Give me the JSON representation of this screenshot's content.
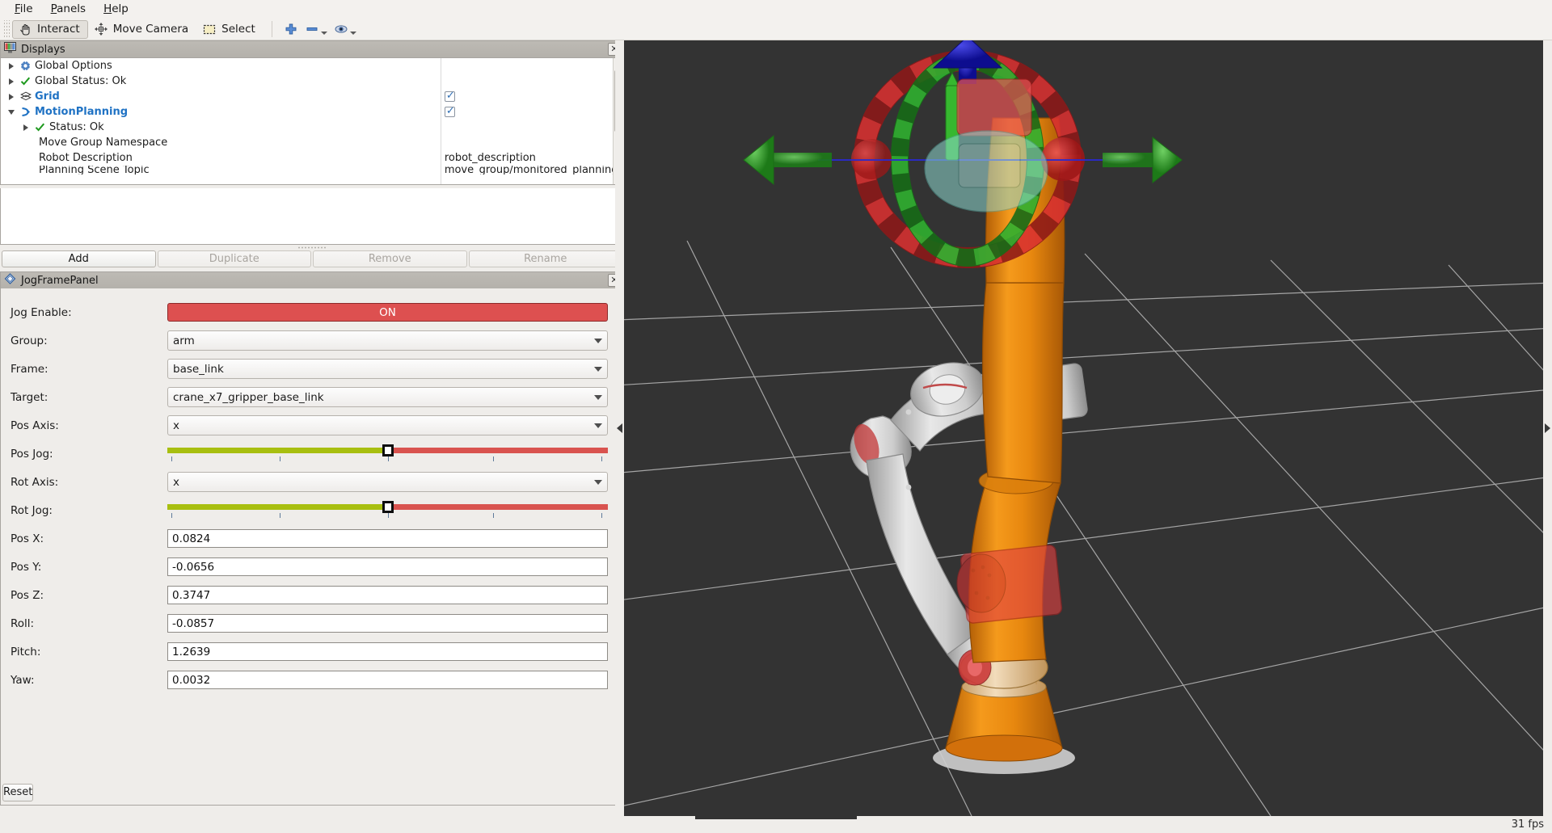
{
  "menubar": {
    "items": [
      {
        "label": "File",
        "mnemonic": "F"
      },
      {
        "label": "Panels",
        "mnemonic": "P"
      },
      {
        "label": "Help",
        "mnemonic": "H"
      }
    ]
  },
  "toolbar": {
    "interact_label": "Interact",
    "move_camera_label": "Move Camera",
    "select_label": "Select",
    "interact_icon": "hand-cursor-icon",
    "move_camera_icon": "four-way-arrow-icon",
    "select_icon": "dashed-rectangle-icon",
    "plus_icon": "plus-icon",
    "minus_icon": "minus-icon",
    "eye_icon": "eye-icon"
  },
  "displays_panel": {
    "title": "Displays",
    "title_icon": "displays-icon",
    "close_label": "✕",
    "rows": [
      {
        "indent": 0,
        "expander": "right",
        "icon": "gear-icon",
        "label": "Global Options",
        "link": false,
        "checkbox": null,
        "value": ""
      },
      {
        "indent": 0,
        "expander": "right",
        "icon": "check-icon",
        "label": "Global Status: Ok",
        "link": false,
        "checkbox": null,
        "value": ""
      },
      {
        "indent": 0,
        "expander": "right",
        "icon": "grid-icon",
        "label": "Grid",
        "link": true,
        "checkbox": true,
        "value": ""
      },
      {
        "indent": 0,
        "expander": "down",
        "icon": "motionplanning-icon",
        "label": "MotionPlanning",
        "link": true,
        "checkbox": true,
        "value": ""
      },
      {
        "indent": 1,
        "expander": "right",
        "icon": "check-icon",
        "label": "Status: Ok",
        "link": false,
        "checkbox": null,
        "value": ""
      },
      {
        "indent": 1,
        "expander": "none",
        "icon": "none",
        "label": "Move Group Namespace",
        "link": false,
        "checkbox": null,
        "value": ""
      },
      {
        "indent": 1,
        "expander": "none",
        "icon": "none",
        "label": "Robot Description",
        "link": false,
        "checkbox": null,
        "value": "robot_description"
      },
      {
        "indent": 1,
        "expander": "none",
        "icon": "none",
        "label": "Planning Scene Topic",
        "link": false,
        "checkbox": null,
        "value": "move_group/monitored_planning_"
      }
    ],
    "buttons": [
      {
        "label": "Add",
        "enabled": true
      },
      {
        "label": "Duplicate",
        "enabled": false
      },
      {
        "label": "Remove",
        "enabled": false
      },
      {
        "label": "Rename",
        "enabled": false
      }
    ]
  },
  "jog_panel": {
    "title": "JogFramePanel",
    "title_icon": "diamond-icon",
    "close_label": "✕",
    "reset_label": "Reset",
    "fields": [
      {
        "key": "jog_enable",
        "label": "Jog Enable:",
        "type": "toggle",
        "value": "ON"
      },
      {
        "key": "group",
        "label": "Group:",
        "type": "combo",
        "value": "arm"
      },
      {
        "key": "frame",
        "label": "Frame:",
        "type": "combo",
        "value": "base_link"
      },
      {
        "key": "target",
        "label": "Target:",
        "type": "combo",
        "value": "crane_x7_gripper_base_link"
      },
      {
        "key": "pos_axis",
        "label": "Pos Axis:",
        "type": "combo",
        "value": "x"
      },
      {
        "key": "pos_jog",
        "label": "Pos Jog:",
        "type": "slider",
        "value": 50
      },
      {
        "key": "rot_axis",
        "label": "Rot Axis:",
        "type": "combo",
        "value": "x"
      },
      {
        "key": "rot_jog",
        "label": "Rot Jog:",
        "type": "slider",
        "value": 50
      },
      {
        "key": "pos_x",
        "label": "Pos X:",
        "type": "text",
        "value": "0.0824"
      },
      {
        "key": "pos_y",
        "label": "Pos Y:",
        "type": "text",
        "value": "-0.0656"
      },
      {
        "key": "pos_z",
        "label": "Pos Z:",
        "type": "text",
        "value": "0.3747"
      },
      {
        "key": "roll",
        "label": "Roll:",
        "type": "text",
        "value": "-0.0857"
      },
      {
        "key": "pitch",
        "label": "Pitch:",
        "type": "text",
        "value": "1.2639"
      },
      {
        "key": "yaw",
        "label": "Yaw:",
        "type": "text",
        "value": "0.0032"
      }
    ]
  },
  "viewport": {
    "background_color": "#333333",
    "grid_color": "#b9b9b9",
    "robot_color": "#e8880f",
    "ghost_color": "#d8d8d8",
    "marker": {
      "ring_red": "#b51f1f",
      "ring_green": "#1f8a1f",
      "arrow_green": "#3aa832",
      "arrow_blue": "#1b1bc8",
      "sphere_red": "#cc2222"
    },
    "collapse_left_icon": "collapse-left-icon",
    "collapse_right_icon": "collapse-right-icon"
  },
  "statusbar": {
    "fps": "31 fps"
  }
}
